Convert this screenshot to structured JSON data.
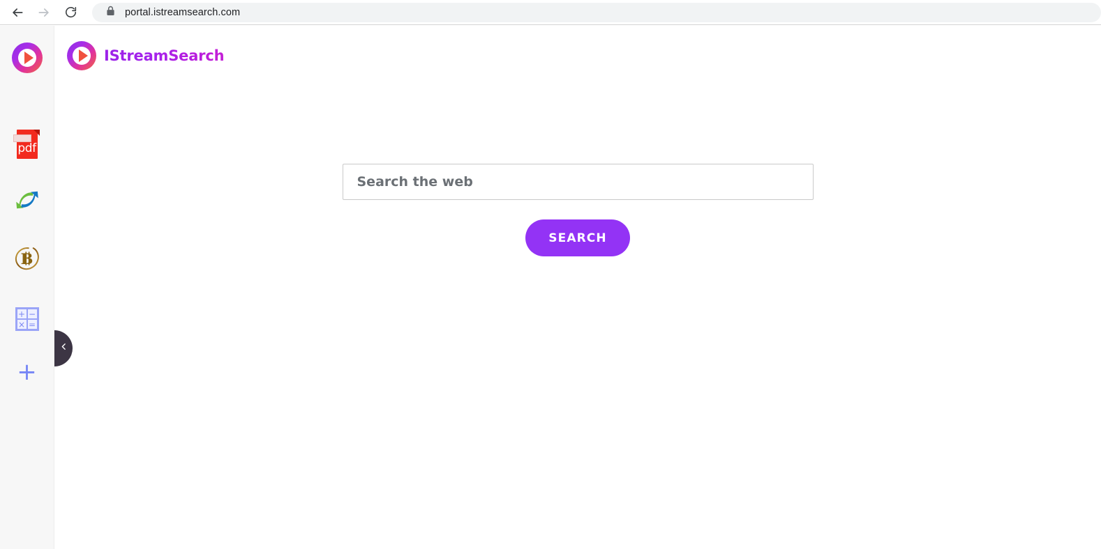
{
  "browser": {
    "back_icon": "arrow-left-icon",
    "forward_icon": "arrow-right-icon",
    "reload_icon": "reload-icon",
    "lock_icon": "lock-icon",
    "url": "portal.istreamsearch.com"
  },
  "sidebar": {
    "collapse_icon": "chevron-left-icon",
    "items": [
      {
        "name": "istreamsearch-logo",
        "icon": "play-circle-logo-icon",
        "label": ""
      },
      {
        "name": "pdf-tool",
        "icon": "pdf-file-icon",
        "label": "pdf"
      },
      {
        "name": "converter-tool",
        "icon": "convert-arrows-icon",
        "label": ""
      },
      {
        "name": "bitcoin-tool",
        "icon": "bitcoin-icon",
        "label": "B"
      },
      {
        "name": "calculator-tool",
        "icon": "calculator-icon",
        "label": ""
      },
      {
        "name": "add-shortcut",
        "icon": "plus-icon",
        "label": "+"
      }
    ],
    "calculator_keys": [
      "+",
      "−",
      "×",
      "="
    ]
  },
  "header": {
    "logo_icon": "play-circle-logo-icon",
    "brand": "IStreamSearch"
  },
  "search": {
    "placeholder": "Search the web",
    "value": "",
    "button_label": "SEARCH"
  },
  "colors": {
    "accent_purple": "#9333f5",
    "brand_gradient_start": "#9b22e8",
    "brand_gradient_end": "#c41fd6",
    "sidebar_bg": "#f7f7f7",
    "handle_bg": "#3c3544",
    "pdf_red": "#f22a1e",
    "bitcoin_gold": "#8a6412",
    "calc_blue": "#7c87f2"
  }
}
